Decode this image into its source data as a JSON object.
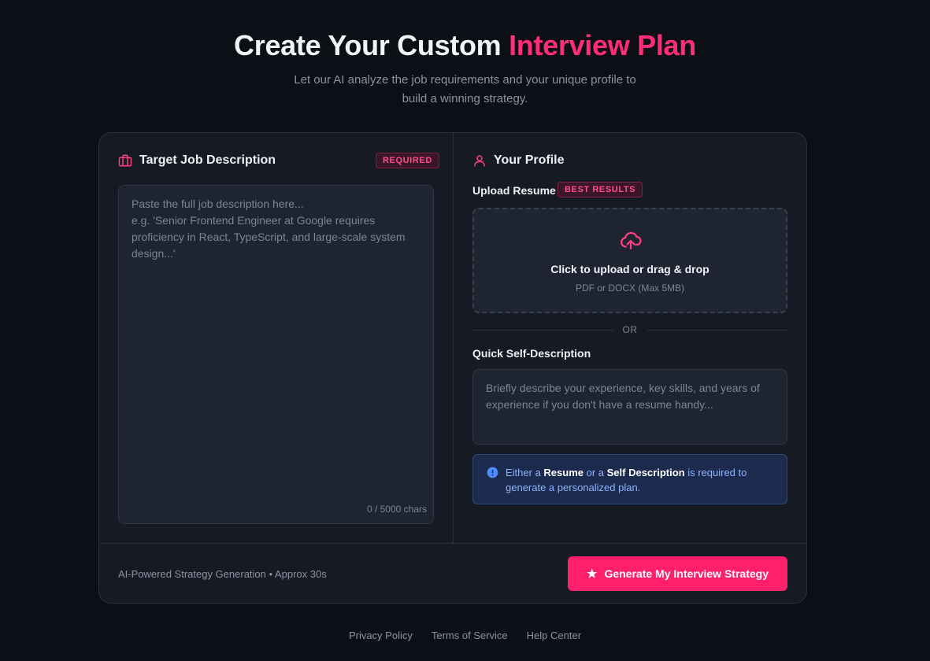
{
  "hero": {
    "title_main": "Create Your Custom ",
    "title_accent": "Interview Plan",
    "subtitle": "Let our AI analyze the job requirements and your unique profile to build a winning strategy."
  },
  "job": {
    "title": "Target Job Description",
    "badge": "REQUIRED",
    "icon": "briefcase-icon",
    "placeholder": "Paste the full job description here...\ne.g. 'Senior Frontend Engineer at Google requires proficiency in React, TypeScript, and large-scale system design...'",
    "char_count": "0 / 5000 chars"
  },
  "profile": {
    "title": "Your Profile",
    "icon": "user-icon",
    "upload_label": "Upload Resume",
    "upload_badge": "BEST RESULTS",
    "upload_title": "Click to upload or drag & drop",
    "upload_sub": "PDF or DOCX (Max 5MB)",
    "upload_icon": "cloud-upload-icon",
    "or_text": "OR",
    "self_label": "Quick Self-Description",
    "self_placeholder": "Briefly describe your experience, key skills, and years of experience if you don't have a resume handy...",
    "notice": {
      "icon": "info-icon",
      "part1": "Either a ",
      "resume": "Resume",
      "part2": " or a ",
      "self": "Self Description",
      "part3": " is required to generate a personalized plan."
    }
  },
  "footer": {
    "meta": "AI-Powered Strategy Generation • Approx 30s",
    "button_icon": "★",
    "button_label": "Generate My Interview Strategy"
  },
  "links": [
    "Privacy Policy",
    "Terms of Service",
    "Help Center"
  ],
  "colors": {
    "background": "#0c0f16",
    "card": "#161a23",
    "accent": "#ff1f6b",
    "notice_bg": "#1c2a4d",
    "notice_text": "#8fb4ff"
  }
}
